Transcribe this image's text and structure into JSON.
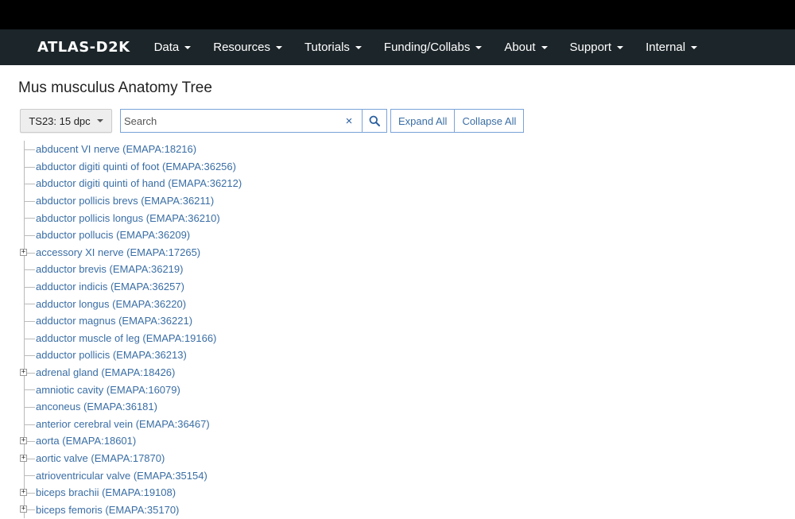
{
  "navbar": {
    "brand": "ATLAS-D2K",
    "items": [
      {
        "label": "Data"
      },
      {
        "label": "Resources"
      },
      {
        "label": "Tutorials"
      },
      {
        "label": "Funding/Collabs"
      },
      {
        "label": "About"
      },
      {
        "label": "Support"
      },
      {
        "label": "Internal"
      }
    ]
  },
  "page": {
    "title": "Mus musculus Anatomy Tree"
  },
  "controls": {
    "stage_label": "TS23: 15 dpc",
    "search_placeholder": "Search",
    "search_value": "",
    "clear_label": "×",
    "expand_all": "Expand All",
    "collapse_all": "Collapse All"
  },
  "tree": [
    {
      "label": "abducent VI nerve (EMAPA:18216)",
      "expandable": false
    },
    {
      "label": "abductor digiti quinti of foot (EMAPA:36256)",
      "expandable": false
    },
    {
      "label": "abductor digiti quinti of hand (EMAPA:36212)",
      "expandable": false
    },
    {
      "label": "abductor pollicis brevs (EMAPA:36211)",
      "expandable": false
    },
    {
      "label": "abductor pollicis longus (EMAPA:36210)",
      "expandable": false
    },
    {
      "label": "abductor pollucis (EMAPA:36209)",
      "expandable": false
    },
    {
      "label": "accessory XI nerve (EMAPA:17265)",
      "expandable": true
    },
    {
      "label": "adductor brevis (EMAPA:36219)",
      "expandable": false
    },
    {
      "label": "adductor indicis (EMAPA:36257)",
      "expandable": false
    },
    {
      "label": "adductor longus (EMAPA:36220)",
      "expandable": false
    },
    {
      "label": "adductor magnus (EMAPA:36221)",
      "expandable": false
    },
    {
      "label": "adductor muscle of leg (EMAPA:19166)",
      "expandable": false
    },
    {
      "label": "adductor pollicis (EMAPA:36213)",
      "expandable": false
    },
    {
      "label": "adrenal gland (EMAPA:18426)",
      "expandable": true
    },
    {
      "label": "amniotic cavity (EMAPA:16079)",
      "expandable": false
    },
    {
      "label": "anconeus (EMAPA:36181)",
      "expandable": false
    },
    {
      "label": "anterior cerebral vein (EMAPA:36467)",
      "expandable": false
    },
    {
      "label": "aorta (EMAPA:18601)",
      "expandable": true
    },
    {
      "label": "aortic valve (EMAPA:17870)",
      "expandable": true
    },
    {
      "label": "atrioventricular valve (EMAPA:35154)",
      "expandable": false
    },
    {
      "label": "biceps brachii (EMAPA:19108)",
      "expandable": true
    },
    {
      "label": "biceps femoris (EMAPA:35170)",
      "expandable": true
    }
  ]
}
